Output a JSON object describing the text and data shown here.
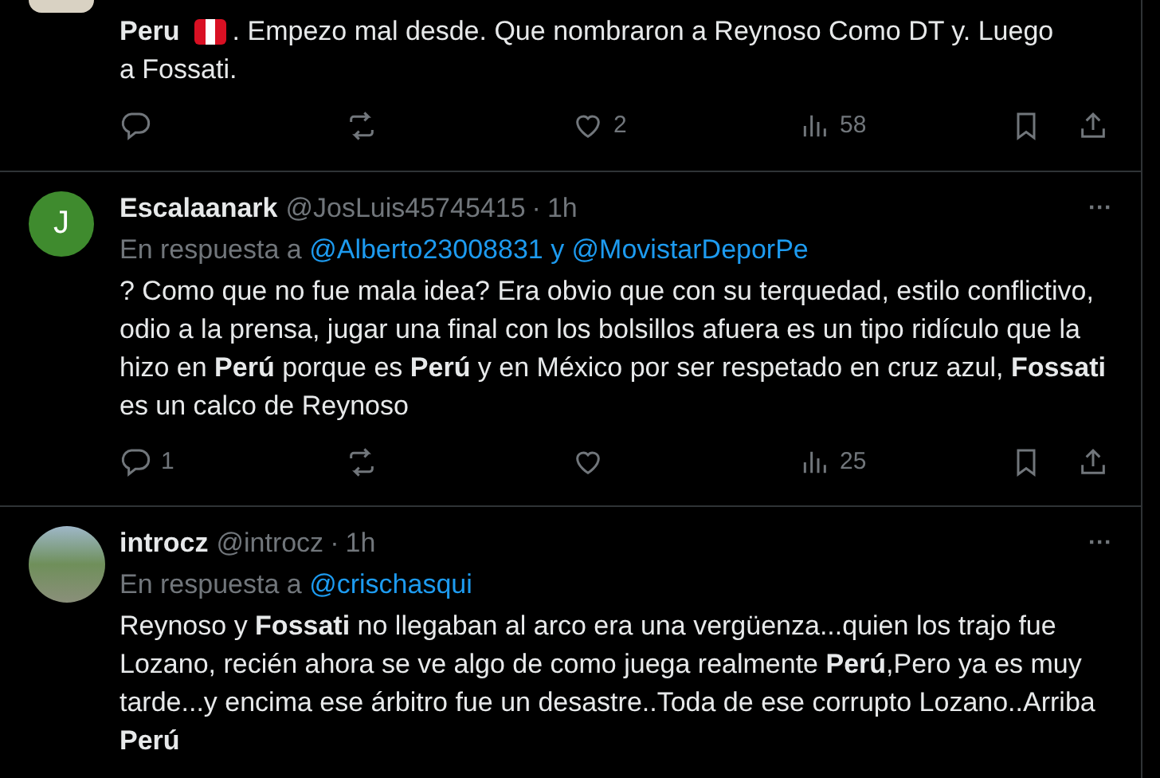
{
  "tweets": [
    {
      "avatar": {
        "kind": "cut"
      },
      "body": [
        {
          "kind": "text",
          "text": "**Peru**"
        },
        {
          "kind": "flag"
        },
        {
          "kind": "text",
          "text": ". Empezo mal desde. Que nombraron a Reynoso Como DT y. Luego"
        },
        {
          "kind": "text",
          "text": "a Fossati."
        }
      ],
      "actions": {
        "likes": "2",
        "views": "58"
      }
    },
    {
      "avatar": {
        "kind": "letter",
        "letter": "J",
        "color": "#3f8b2e"
      },
      "name": "Escalaanark",
      "handle": "@JosLuis45745415",
      "sep": "·",
      "time": "1h",
      "more": "···",
      "reply_prefix": "En respuesta a",
      "reply_to": "@Alberto23008831 y @MovistarDeporPe",
      "body": [
        {
          "kind": "text",
          "text": "? Como que no fue mala idea?  Era obvio que con su terquedad, estilo conflictivo, odio a la prensa, jugar una final con los bolsillos afuera es un tipo ridículo que la hizo en **Perú** porque es **Perú** y en México por ser respetado en cruz azul, **Fossati** es un calco de Reynoso"
        }
      ],
      "actions": {
        "replies": "1",
        "views": "25"
      }
    },
    {
      "avatar": {
        "kind": "photo"
      },
      "name": "introcz",
      "handle": "@introcz",
      "sep": "·",
      "time": "1h",
      "more": "···",
      "reply_prefix": "En respuesta a",
      "reply_to": "@crischasqui",
      "body": [
        {
          "kind": "text",
          "text": "Reynoso y **Fossati** no llegaban al arco era una vergüenza...quien los trajo fue Lozano, recién ahora se   ve algo de como juega realmente **Perú**,Pero ya es muy tarde...y encima ese árbitro fue un desastre..Toda de ese corrupto Lozano..Arriba **Perú**"
        }
      ]
    }
  ]
}
